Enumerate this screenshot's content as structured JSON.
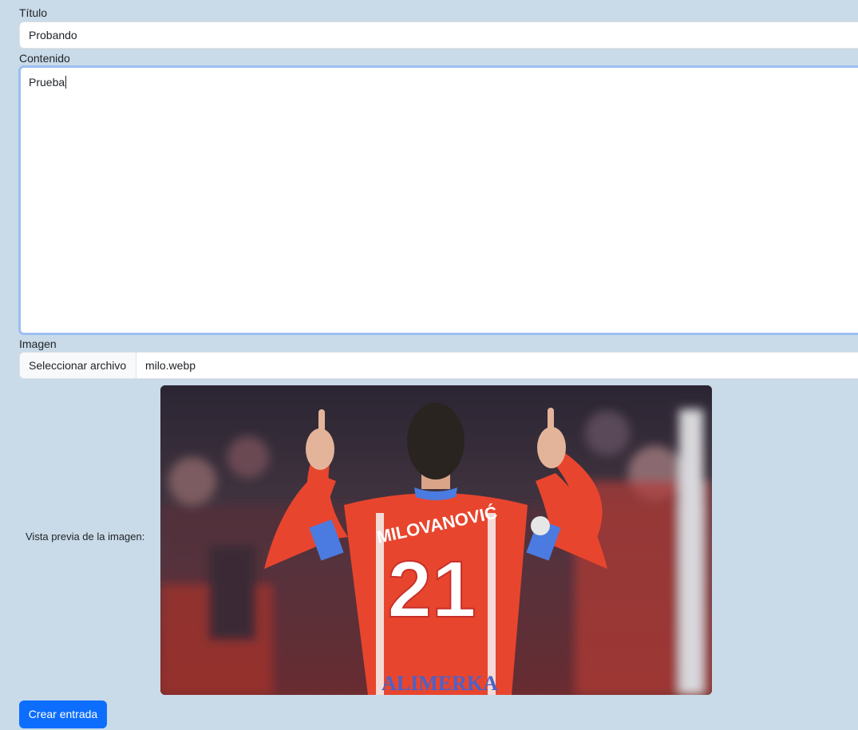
{
  "form": {
    "title_label": "Título",
    "title_value": "Probando",
    "content_label": "Contenido",
    "content_value": "Prueba",
    "image_label": "Imagen",
    "file_button_label": "Seleccionar archivo",
    "file_name": "milo.webp",
    "preview_label": "Vista previa de la imagen:",
    "submit_label": "Crear entrada"
  },
  "preview_image": {
    "jersey_name": "MILOVANOVIĆ",
    "jersey_number": "21",
    "sponsor": "ALIMERKA"
  },
  "colors": {
    "background": "#c9dae8",
    "primary": "#0d6efd",
    "focus_border": "#9dbef4",
    "jersey_red": "#e8452e"
  }
}
